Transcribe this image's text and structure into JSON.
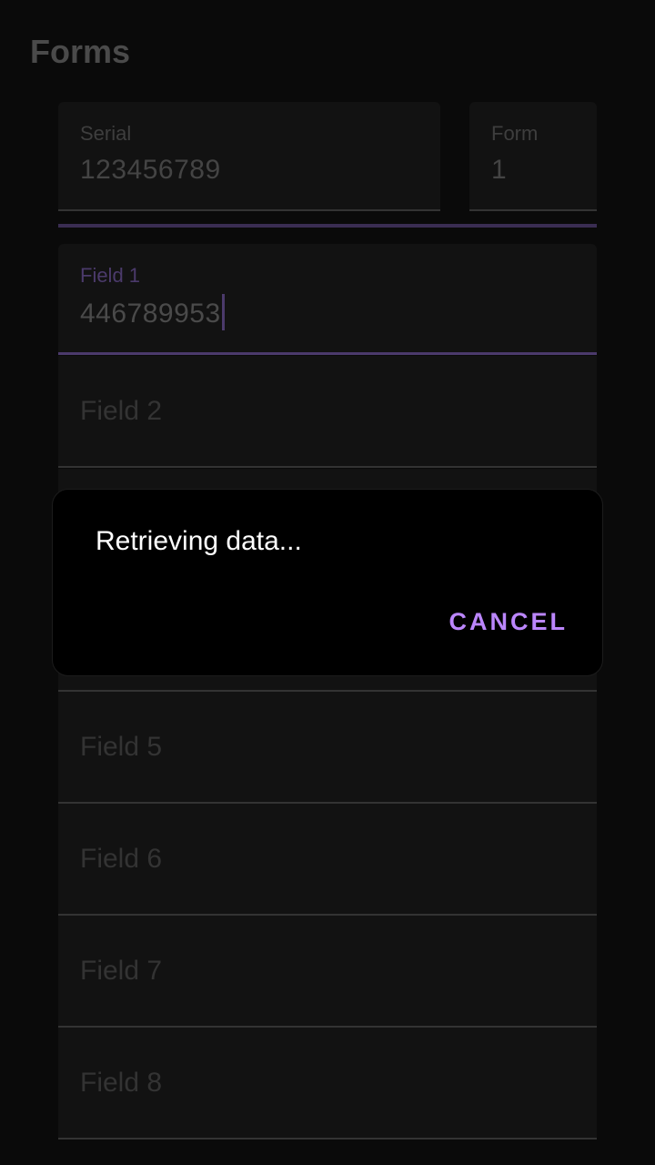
{
  "page": {
    "title": "Forms"
  },
  "header_fields": {
    "serial": {
      "label": "Serial",
      "value": "123456789"
    },
    "form": {
      "label": "Form",
      "value": "1"
    }
  },
  "fields": {
    "field1": {
      "label": "Field 1",
      "value": "446789953"
    },
    "field2": {
      "placeholder": "Field 2"
    },
    "field5": {
      "placeholder": "Field 5"
    },
    "field6": {
      "placeholder": "Field 6"
    },
    "field7": {
      "placeholder": "Field 7"
    },
    "field8": {
      "placeholder": "Field 8"
    }
  },
  "dialog": {
    "message": "Retrieving data...",
    "cancel_label": "CANCEL"
  },
  "colors": {
    "accent": "#bb86fc",
    "focus_line": "#4b3a6b",
    "background": "#0a0a0a",
    "field_bg": "#121212"
  }
}
